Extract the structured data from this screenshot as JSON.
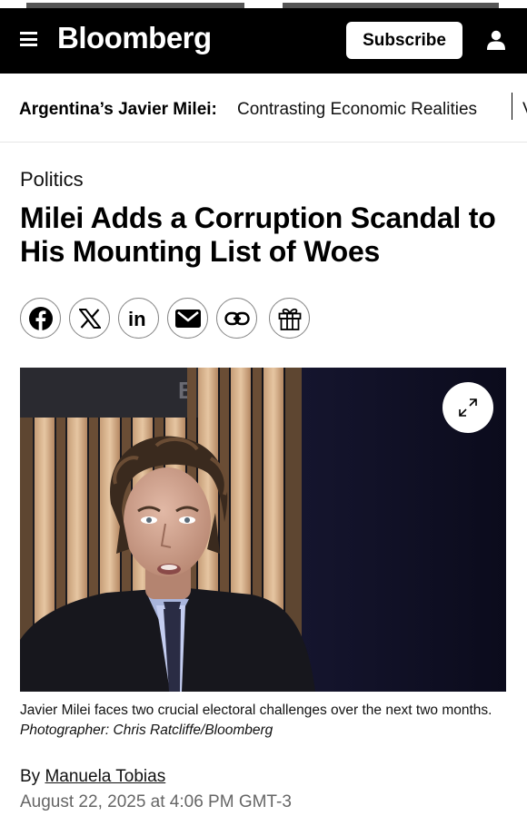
{
  "header": {
    "logo": "Bloomberg",
    "subscribe_label": "Subscribe",
    "background": "#000000"
  },
  "topic_bar": {
    "label": "Argentina’s Javier Milei:",
    "story_title": "Contrasting Economic Realities",
    "next_story_initial": "V"
  },
  "article": {
    "section": "Politics",
    "headline": "Milei Adds a Corruption Scandal to His Mounting List of Woes",
    "share_buttons": [
      "facebook-icon",
      "x-icon",
      "linkedin-icon",
      "email-icon",
      "link-icon",
      "gift-icon"
    ],
    "photo": {
      "caption": "Javier Milei faces two crucial electoral challenges over the next two months.",
      "credit": "Photographer: Chris Ratcliffe/Bloomberg",
      "backdrop_letter": "B"
    },
    "byline_prefix": "By",
    "author": "Manuela Tobias",
    "date": "August 22, 2025 at 4:06 PM GMT-3"
  }
}
